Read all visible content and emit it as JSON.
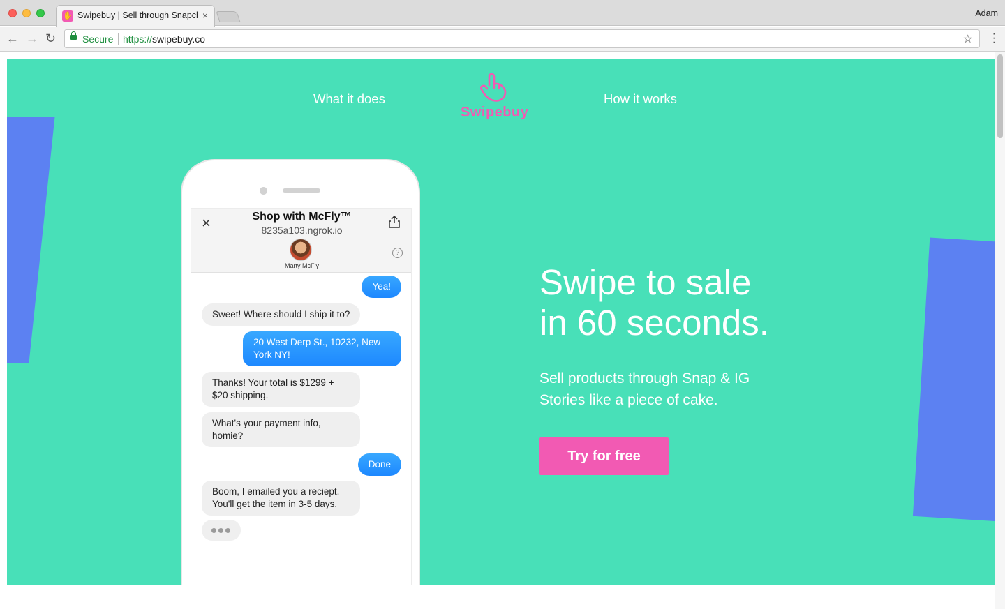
{
  "browser": {
    "tab_title": "Swipebuy | Sell through Snapchat",
    "tab_close": "×",
    "profile_name": "Adam",
    "secure_label": "Secure",
    "url_scheme": "https://",
    "url_host": "swipebuy.co"
  },
  "nav": {
    "what_it_does": "What it does",
    "how_it_works": "How it works",
    "logo_text": "Swipebuy"
  },
  "hero": {
    "title_line1": "Swipe to sale",
    "title_line2": "in 60 seconds.",
    "subtitle": "Sell products through Snap & IG Stories like a piece of cake.",
    "cta_label": "Try for free"
  },
  "chat": {
    "close_icon": "×",
    "title": "Shop with McFly™",
    "host": "8235a103.ngrok.io",
    "agent_name": "Marty McFly",
    "help_glyph": "?",
    "messages": [
      {
        "from": "user",
        "text": "Yea!"
      },
      {
        "from": "bot",
        "text": "Sweet! Where should I ship it to?"
      },
      {
        "from": "user",
        "text": "20 West Derp St., 10232, New York NY!"
      },
      {
        "from": "bot",
        "text": "Thanks! Your total is $1299 + $20 shipping."
      },
      {
        "from": "bot",
        "text": "What's your payment info, homie?"
      },
      {
        "from": "user",
        "text": "Done"
      },
      {
        "from": "bot",
        "text": "Boom, I emailed you a reciept. You'll get the item in 3-5 days."
      }
    ]
  },
  "colors": {
    "page_bg": "#48e0b8",
    "brand_pink": "#f25ab3",
    "accent_blue": "#5c81f2",
    "bubble_blue": "#1d88ff"
  }
}
